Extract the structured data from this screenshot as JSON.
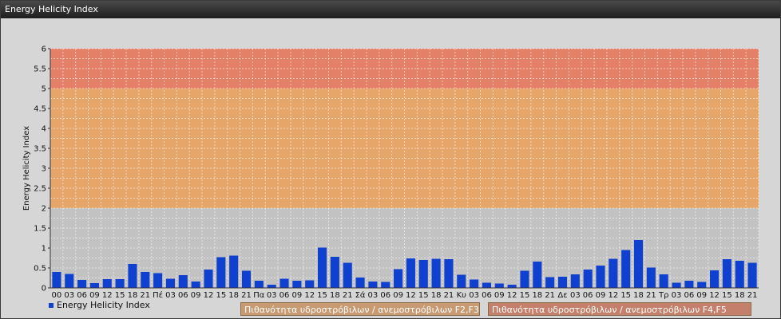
{
  "window": {
    "title": "Energy Helicity Index"
  },
  "legend": {
    "series_label": "Energy Helicity Index"
  },
  "band_labels": [
    {
      "text": "Πιθανότητα υδροστρόβιλων / ανεμοστρόβιλων F2,F3",
      "color": "#c89a72"
    },
    {
      "text": "Πιθανότητα υδροστρόβιλων / ανεμοστρόβιλων F4,F5",
      "color": "#c4806a"
    }
  ],
  "chart_data": {
    "type": "bar",
    "title": "",
    "xlabel": "",
    "ylabel": "Energy Helicity Index",
    "ylim": [
      0,
      6
    ],
    "yticks": [
      "0",
      "0.5",
      "1",
      "1.5",
      "2",
      "2.5",
      "3",
      "3.5",
      "4",
      "4.5",
      "5",
      "5.5",
      "6"
    ],
    "grid": true,
    "bar_color": "#1040d0",
    "bands": [
      {
        "from": 2,
        "to": 5,
        "color": "#e6a66a"
      },
      {
        "from": 5,
        "to": 6,
        "color": "#e48068"
      }
    ],
    "categories": [
      "00",
      "03",
      "06",
      "09",
      "12",
      "15",
      "18",
      "21",
      "Πέ",
      "03",
      "06",
      "09",
      "12",
      "15",
      "18",
      "21",
      "Πα",
      "03",
      "06",
      "09",
      "12",
      "15",
      "18",
      "21",
      "Σά",
      "03",
      "06",
      "09",
      "12",
      "15",
      "18",
      "21",
      "Κυ",
      "03",
      "06",
      "09",
      "12",
      "15",
      "18",
      "21",
      "Δε",
      "03",
      "06",
      "09",
      "12",
      "15",
      "18",
      "21",
      "Τρ",
      "03",
      "06",
      "09",
      "12",
      "15",
      "18",
      "21"
    ],
    "series": [
      {
        "name": "Energy Helicity Index",
        "values": [
          0.4,
          0.35,
          0.2,
          0.12,
          0.22,
          0.22,
          0.6,
          0.4,
          0.37,
          0.23,
          0.32,
          0.16,
          0.46,
          0.77,
          0.81,
          0.43,
          0.18,
          0.08,
          0.23,
          0.18,
          0.19,
          1.01,
          0.78,
          0.63,
          0.26,
          0.16,
          0.15,
          0.47,
          0.74,
          0.7,
          0.73,
          0.72,
          0.33,
          0.21,
          0.13,
          0.11,
          0.08,
          0.43,
          0.66,
          0.27,
          0.28,
          0.34,
          0.46,
          0.56,
          0.73,
          0.95,
          1.2,
          0.51,
          0.34,
          0.13,
          0.18,
          0.15,
          0.44,
          0.72,
          0.68,
          0.63
        ]
      }
    ]
  }
}
